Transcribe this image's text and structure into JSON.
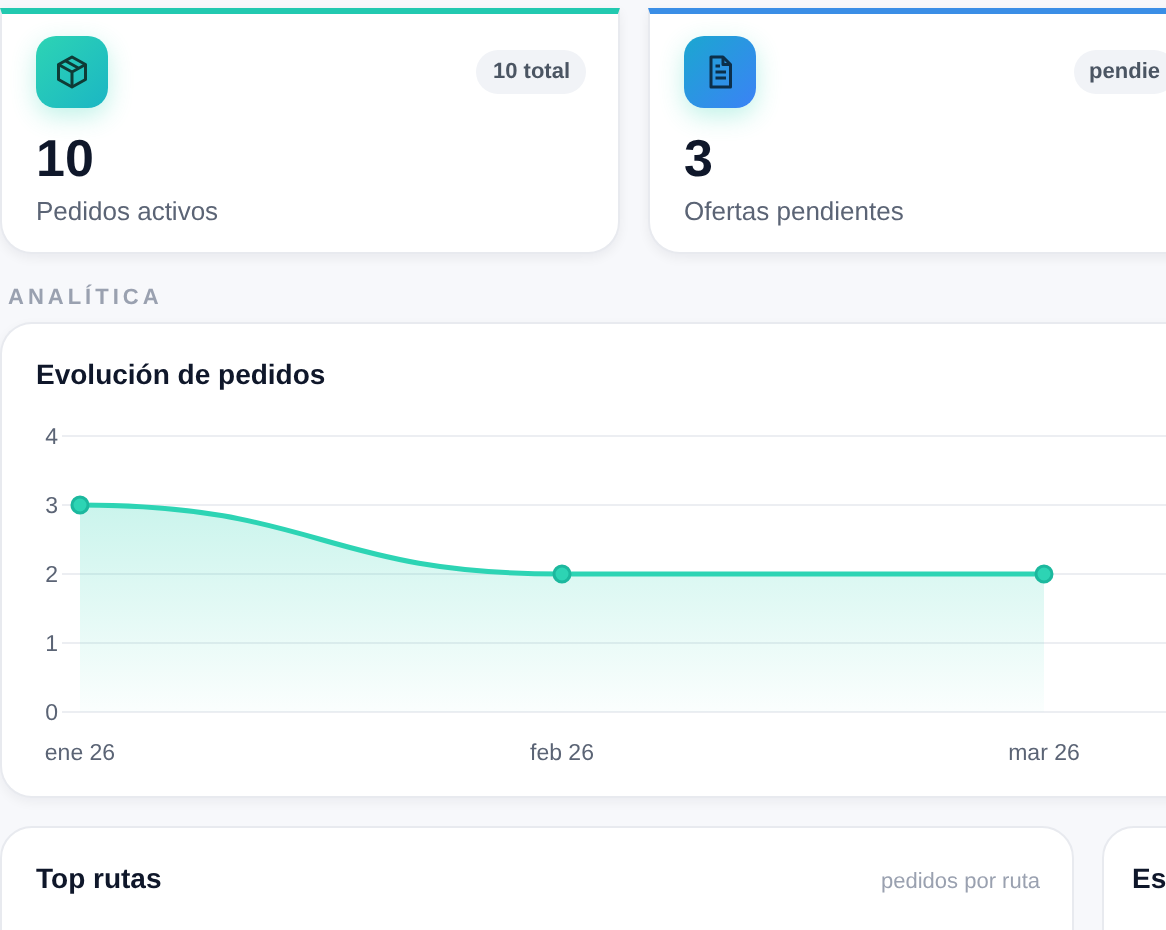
{
  "stats": [
    {
      "value": "10",
      "label": "Pedidos activos",
      "badge": "10 total",
      "kind": "package"
    },
    {
      "value": "3",
      "label": "Ofertas pendientes",
      "badge": "pendie",
      "kind": "document"
    }
  ],
  "section_label": "ANALÍTICA",
  "orders_chart": {
    "title": "Evolución de pedidos",
    "chart_data": {
      "type": "area",
      "categories": [
        "ene 26",
        "feb 26",
        "mar 26"
      ],
      "series": [
        {
          "color": "#2dd4b4",
          "values": [
            3,
            2,
            2
          ]
        }
      ],
      "ylim": [
        0,
        4
      ],
      "grid": true,
      "yticks": [
        0,
        1,
        2,
        3,
        4
      ]
    }
  },
  "bottom_cards": [
    {
      "title": "Top rutas",
      "subtitle": "pedidos por ruta"
    },
    {
      "title": "Es"
    }
  ]
}
